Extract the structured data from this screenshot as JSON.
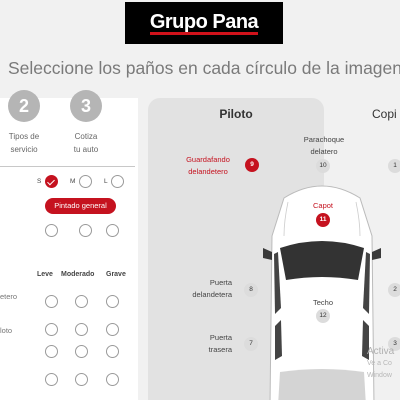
{
  "brand": {
    "logo_text": "Grupo Pana"
  },
  "title": "Seleccione los paños en cada círculo de la imagen",
  "steps": [
    {
      "number": "2",
      "label_line1": "Tipos de",
      "label_line2": "servicio"
    },
    {
      "number": "3",
      "label_line1": "Cotiza",
      "label_line2": "tu auto"
    }
  ],
  "sizes": {
    "s": "S",
    "m": "M",
    "l": "L",
    "selected": "S"
  },
  "general_paint_button": "Pintado general",
  "damage_levels": {
    "leve": "Leve",
    "moderado": "Moderado",
    "grave": "Grave"
  },
  "row_labels": [
    "etero",
    "loto"
  ],
  "views": {
    "piloto": "Piloto",
    "copiloto_partial": "Copi"
  },
  "parts": {
    "guardafango": {
      "line1": "Guardafando",
      "line2": "delandetero",
      "number": "9",
      "selected": true
    },
    "parachoque": {
      "line1": "Parachoque",
      "line2": "delatero",
      "number": "10",
      "selected": false
    },
    "capot": {
      "line1": "Capot",
      "number": "11",
      "selected": true
    },
    "techo": {
      "line1": "Techo",
      "number": "12",
      "selected": false
    },
    "puerta_del": {
      "line1": "Puerta",
      "line2": "delandetera",
      "number": "8",
      "selected": false
    },
    "puerta_tra": {
      "line1": "Puerta",
      "line2": "trasera",
      "number": "7",
      "selected": false
    }
  },
  "copiloto_badges": [
    "1",
    "2",
    "3"
  ],
  "watermark": {
    "line1": "Activa",
    "line2": "Ve a Co",
    "line3": "Window"
  },
  "colors": {
    "accent": "#c5121f",
    "background": "#f1f1f1",
    "panel": "#e2e2e2"
  },
  "icons": {
    "check": "check-icon"
  }
}
